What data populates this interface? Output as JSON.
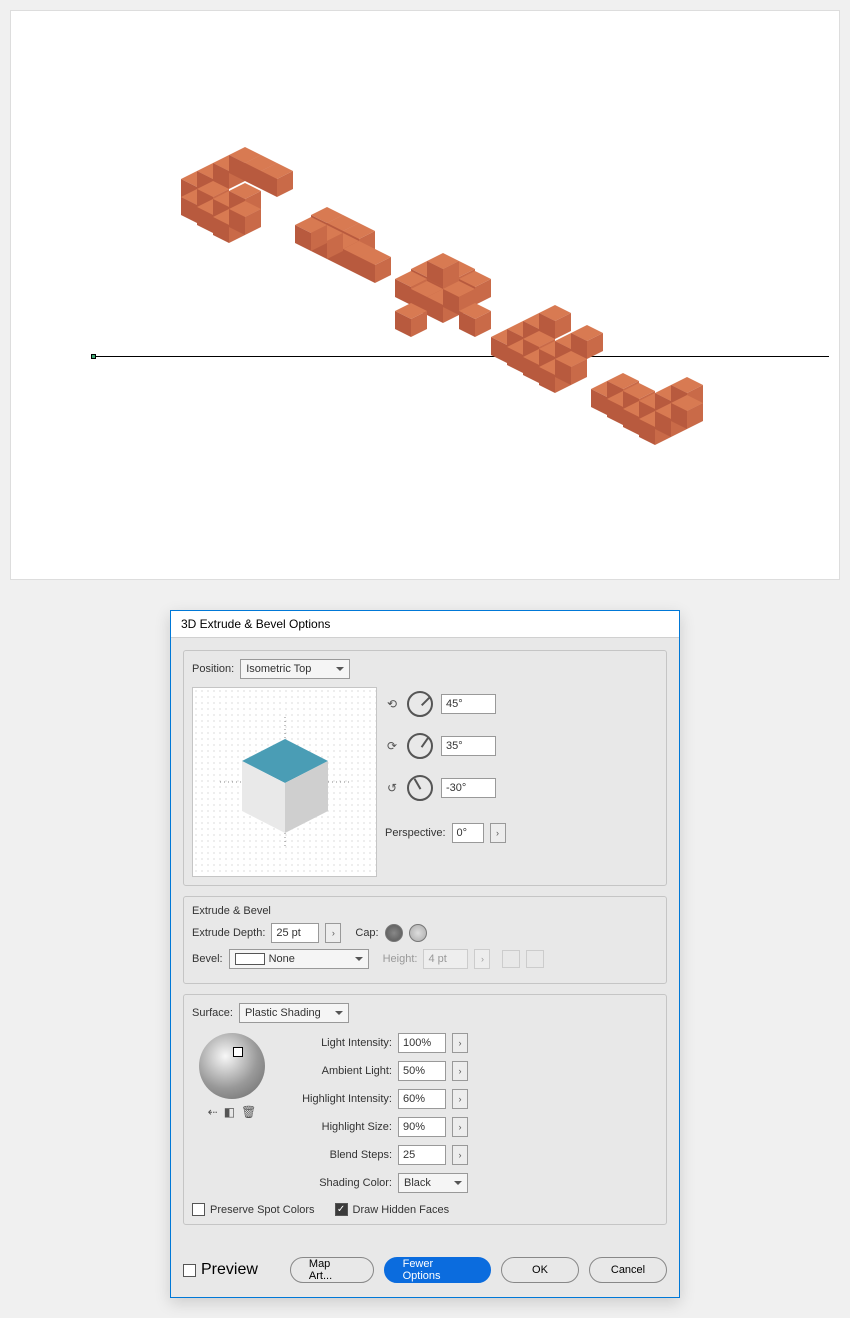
{
  "dialog": {
    "title": "3D Extrude & Bevel Options",
    "position_label": "Position:",
    "position_value": "Isometric Top",
    "rotations": {
      "x": "45°",
      "y": "35°",
      "z": "-30°"
    },
    "perspective_label": "Perspective:",
    "perspective_value": "0°",
    "extrude": {
      "section": "Extrude & Bevel",
      "depth_label": "Extrude Depth:",
      "depth_value": "25 pt",
      "cap_label": "Cap:",
      "bevel_label": "Bevel:",
      "bevel_value": "None",
      "height_label": "Height:",
      "height_value": "4 pt"
    },
    "surface": {
      "label": "Surface:",
      "value": "Plastic Shading",
      "light_intensity_label": "Light Intensity:",
      "light_intensity": "100%",
      "ambient_label": "Ambient Light:",
      "ambient": "50%",
      "highlight_intensity_label": "Highlight Intensity:",
      "highlight_intensity": "60%",
      "highlight_size_label": "Highlight Size:",
      "highlight_size": "90%",
      "blend_steps_label": "Blend Steps:",
      "blend_steps": "25",
      "shading_color_label": "Shading Color:",
      "shading_color": "Black",
      "preserve_spot": "Preserve Spot Colors",
      "draw_hidden": "Draw Hidden Faces"
    },
    "footer": {
      "preview": "Preview",
      "map_art": "Map Art...",
      "fewer": "Fewer Options",
      "ok": "OK",
      "cancel": "Cancel"
    }
  }
}
